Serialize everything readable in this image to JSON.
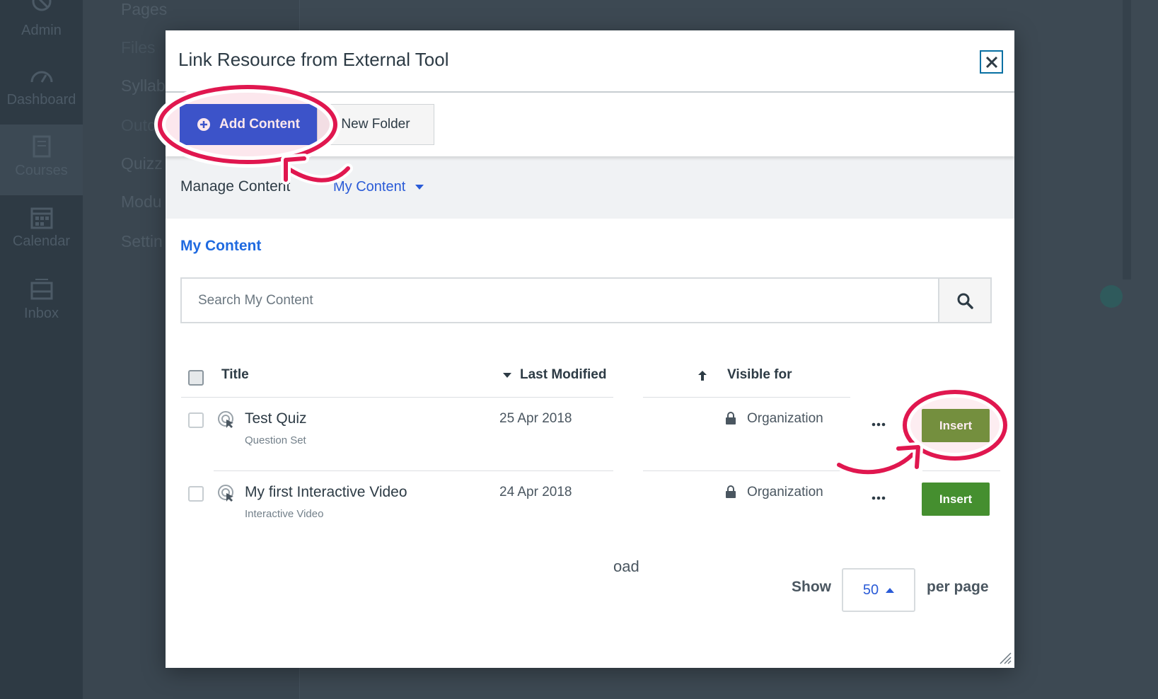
{
  "background": {
    "global_nav": [
      {
        "label": "Admin",
        "icon": "shield-icon"
      },
      {
        "label": "Dashboard",
        "icon": "dashboard-icon"
      },
      {
        "label": "Courses",
        "icon": "book-icon",
        "active": true
      },
      {
        "label": "Calendar",
        "icon": "calendar-icon"
      },
      {
        "label": "Inbox",
        "icon": "inbox-icon"
      }
    ],
    "course_links": [
      "Pages",
      "Files",
      "Syllab",
      "Outc",
      "Quizz",
      "Modu",
      "Settin"
    ]
  },
  "modal": {
    "title": "Link Resource from External Tool",
    "close_icon": "close-icon"
  },
  "toolbar": {
    "add_label": "Add Content",
    "folder_label": "New Folder"
  },
  "manage": {
    "label": "Manage Content",
    "dropdown_value": "My Content"
  },
  "section_title": "My Content",
  "search": {
    "placeholder": "Search My Content",
    "value": ""
  },
  "table": {
    "columns": {
      "title": "Title",
      "last_modified": "Last Modified",
      "visible_for": "Visible for"
    },
    "rows": [
      {
        "title": "Test Quiz",
        "type": "Question Set",
        "date": "25 Apr 2018",
        "visibility": "Organization",
        "action": "Insert"
      },
      {
        "title": "My first Interactive Video",
        "type": "Interactive Video",
        "date": "24 Apr 2018",
        "visibility": "Organization",
        "action": "Insert"
      }
    ]
  },
  "footer": {
    "load_text": "oad",
    "show_label": "Show",
    "per_page_value": "50",
    "per_page_label": "per page"
  },
  "colors": {
    "primary": "#2a5bd7",
    "insert": "#458f2f",
    "highlight": "#e0174f"
  }
}
